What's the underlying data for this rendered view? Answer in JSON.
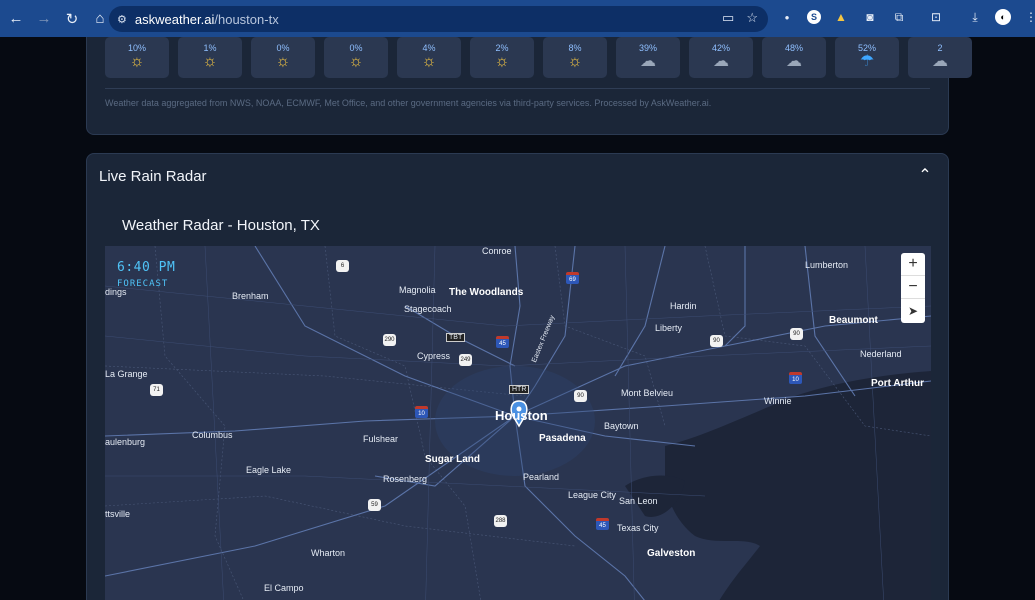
{
  "browser": {
    "url_domain": "askweather.ai",
    "url_path": "/houston-tx"
  },
  "hourly": [
    {
      "pct": "10%",
      "icon": "sun-icon"
    },
    {
      "pct": "1%",
      "icon": "sun-icon"
    },
    {
      "pct": "0%",
      "icon": "sun-icon"
    },
    {
      "pct": "0%",
      "icon": "sun-icon"
    },
    {
      "pct": "4%",
      "icon": "sun-icon"
    },
    {
      "pct": "2%",
      "icon": "sun-icon"
    },
    {
      "pct": "8%",
      "icon": "sun-icon"
    },
    {
      "pct": "39%",
      "icon": "cloud-icon"
    },
    {
      "pct": "42%",
      "icon": "cloud-icon"
    },
    {
      "pct": "48%",
      "icon": "cloud-icon"
    },
    {
      "pct": "52%",
      "icon": "rain-icon"
    },
    {
      "pct": "2",
      "icon": "cloud-icon"
    }
  ],
  "source_note": "Weather data aggregated from NWS, NOAA, ECMWF, Met Office, and other government agencies via third-party services. Processed by AskWeather.ai.",
  "radar": {
    "header": "Live Rain Radar",
    "title": "Weather Radar - Houston, TX",
    "time": "6:40 PM",
    "forecast_label": "FORECAST",
    "zoom_in": "+",
    "zoom_out": "−"
  },
  "map_labels": {
    "conroe": "Conroe",
    "lumberton": "Lumberton",
    "brenham": "Brenham",
    "magnolia": "Magnolia",
    "woodlands": "The Woodlands",
    "hardin": "Hardin",
    "stagecoach": "Stagecoach",
    "liberty": "Liberty",
    "beaumont": "Beaumont",
    "cypress": "Cypress",
    "nederland": "Nederland",
    "lagrange": "La Grange",
    "mont_belvieu": "Mont Belvieu",
    "port_arthur": "Port Arthur",
    "winnie": "Winnie",
    "houston": "Houston",
    "pasadena": "Pasadena",
    "columbus": "Columbus",
    "fulshear": "Fulshear",
    "baytown": "Baytown",
    "sugar_land": "Sugar Land",
    "eagle_lake": "Eagle Lake",
    "rosenberg": "Rosenberg",
    "pearland": "Pearland",
    "league_city": "League City",
    "san_leon": "San Leon",
    "texas_city": "Texas City",
    "wharton": "Wharton",
    "galveston": "Galveston",
    "el_campo": "El Campo",
    "dings": "dings",
    "aulenburg": "aulenburg",
    "ttsville": "ttsville",
    "eastex": "Eastex Freeway",
    "tbt": "TBT",
    "htr": "HTR"
  },
  "shields": {
    "s6": "6",
    "s69": "69",
    "s290": "290",
    "s249": "249",
    "s45a": "45",
    "s90a": "90",
    "s90b": "90",
    "s90c": "90",
    "s10a": "10",
    "s10b": "10",
    "s71": "71",
    "s59": "59",
    "s288": "288",
    "s45b": "45"
  }
}
